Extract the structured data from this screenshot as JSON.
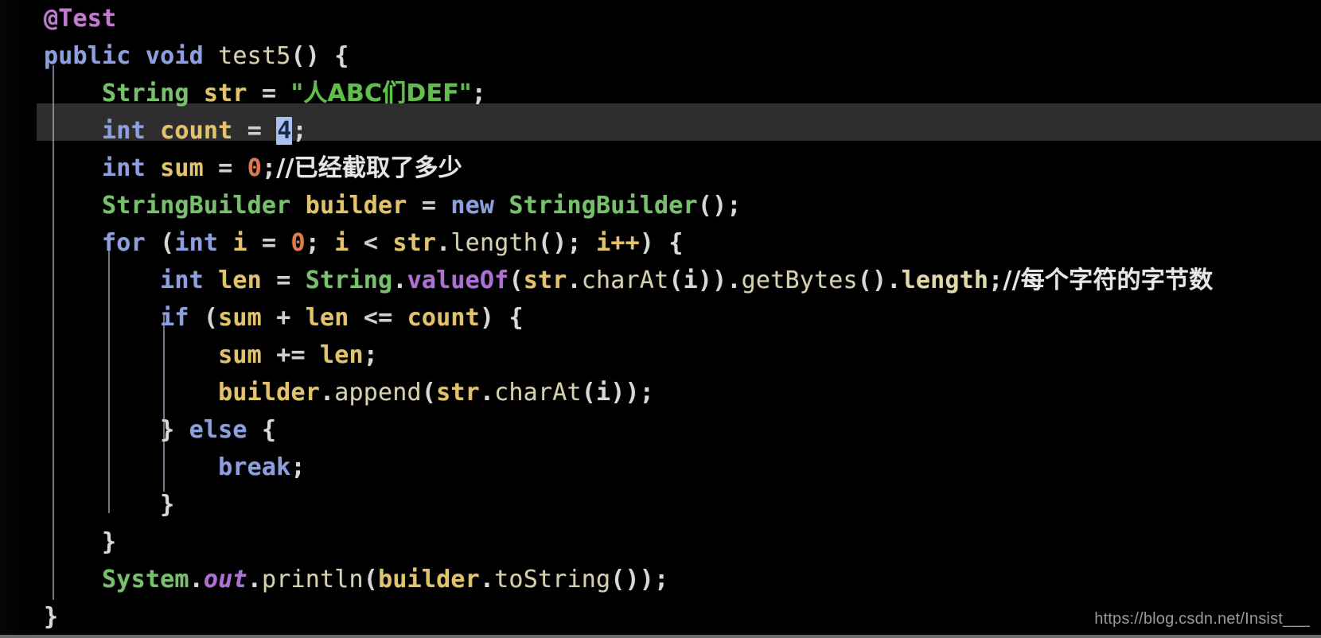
{
  "editor": {
    "language": "Java",
    "theme": "dark",
    "background_color": "#000000",
    "current_line_color": "#2e2e2e",
    "selection_color": "#a9c0f0",
    "indent_guide_color": "#b6bdd6"
  },
  "watermark": {
    "text": "https://blog.csdn.net/Insist___"
  },
  "code": {
    "line1": {
      "annotation": "@Test"
    },
    "line2": {
      "kw_public": "public",
      "kw_void": "void",
      "method": "test5",
      "parens": "()",
      "brace": "{"
    },
    "line3": {
      "type": "String",
      "var": "str",
      "eq": "=",
      "string_literal": "\"人ABC们DEF\"",
      "semi": ";"
    },
    "line4": {
      "kw_int": "int",
      "var": "count",
      "eq": "=",
      "value": "4",
      "semi": ";"
    },
    "line5": {
      "kw_int": "int",
      "var": "sum",
      "eq": "=",
      "value": "0",
      "semi": ";",
      "comment": "//已经截取了多少"
    },
    "line6": {
      "type": "StringBuilder",
      "var": "builder",
      "eq": "=",
      "kw_new": "new",
      "ctor": "StringBuilder",
      "parens": "()",
      "semi": ";"
    },
    "line7": {
      "kw_for": "for",
      "open": "(",
      "kw_int": "int",
      "i": "i",
      "eq": "=",
      "zero": "0",
      "semi1": ";",
      "i2": "i",
      "lt": "<",
      "str": "str",
      "dot": ".",
      "length": "length",
      "parens": "()",
      "semi2": ";",
      "inc": "i++",
      "close": ")",
      "brace": "{"
    },
    "line8": {
      "kw_int": "int",
      "var": "len",
      "eq": "=",
      "type": "String",
      "dot1": ".",
      "valueOf": "valueOf",
      "open": "(",
      "str": "str",
      "dot2": ".",
      "charAt": "charAt",
      "arg": "(i)",
      "close": ")",
      "dot3": ".",
      "getBytes": "getBytes",
      "parens2": "()",
      "dot4": ".",
      "length": "length",
      "semi": ";",
      "comment": "//每个字符的字节数"
    },
    "line9": {
      "kw_if": "if",
      "open": "(",
      "sum": "sum",
      "plus": "+",
      "len": "len",
      "lte": "<=",
      "count": "count",
      "close": ")",
      "brace": "{"
    },
    "line10": {
      "sum": "sum",
      "op": "+=",
      "len": "len",
      "semi": ";"
    },
    "line11": {
      "builder": "builder",
      "dot1": ".",
      "append": "append",
      "open": "(",
      "str": "str",
      "dot2": ".",
      "charAt": "charAt",
      "arg": "(i)",
      "close": ")",
      "semi": ";"
    },
    "line12": {
      "close_brace": "}",
      "kw_else": "else",
      "open_brace": "{"
    },
    "line13": {
      "kw_break": "break",
      "semi": ";"
    },
    "line14": {
      "brace": "}"
    },
    "line15": {
      "brace": "}"
    },
    "line16": {
      "system": "System",
      "dot1": ".",
      "out": "out",
      "dot2": ".",
      "println": "println",
      "open": "(",
      "builder": "builder",
      "dot3": ".",
      "toString": "toString",
      "parens": "()",
      "close": ")",
      "semi": ";"
    },
    "line17": {
      "brace": "}"
    }
  }
}
